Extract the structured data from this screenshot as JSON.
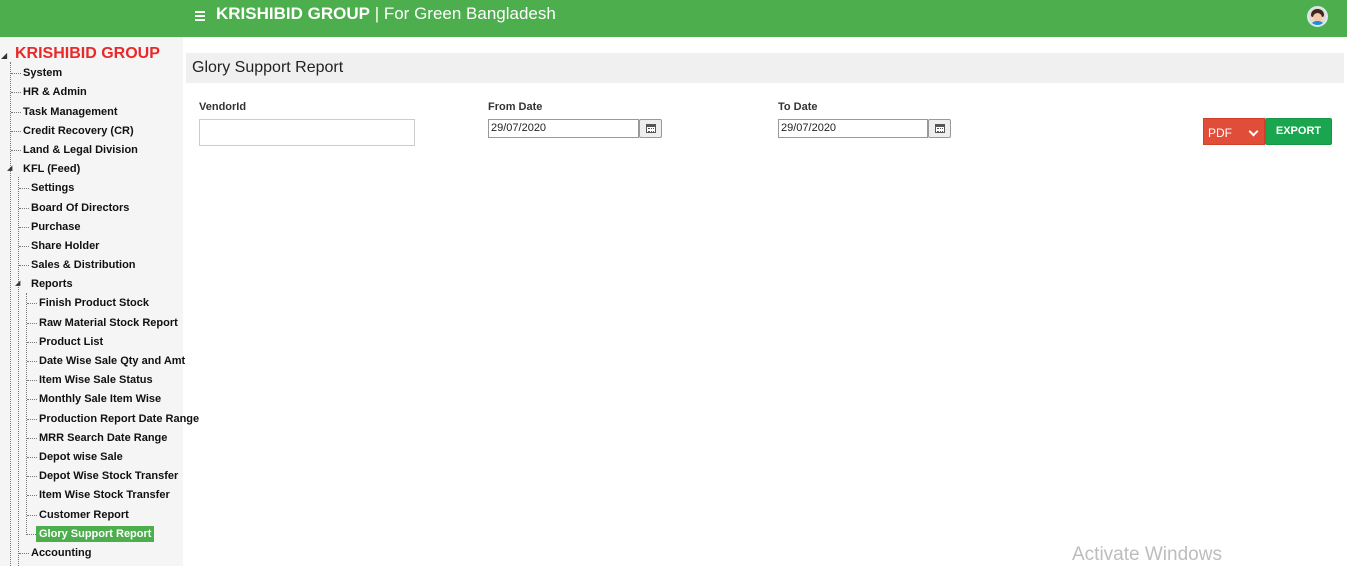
{
  "header": {
    "brand_name": "KRISHIBID GROUP",
    "brand_separator": " | ",
    "brand_tagline": "For Green Bangladesh",
    "colors": {
      "bar": "#4cae4c"
    },
    "icons": [
      "hamburger-menu-icon",
      "user-avatar-icon"
    ]
  },
  "sidebar": {
    "root": "KRISHIBID GROUP",
    "items": [
      {
        "label": "System"
      },
      {
        "label": "HR & Admin"
      },
      {
        "label": "Task Management"
      },
      {
        "label": "Credit Recovery (CR)"
      },
      {
        "label": "Land & Legal Division"
      },
      {
        "label": "KFL (Feed)",
        "expanded": true
      }
    ],
    "kfl_children": [
      {
        "label": "Settings"
      },
      {
        "label": "Board Of Directors"
      },
      {
        "label": "Purchase"
      },
      {
        "label": "Share Holder"
      },
      {
        "label": "Sales & Distribution"
      },
      {
        "label": "Reports",
        "expanded": true
      },
      {
        "label": "Accounting"
      }
    ],
    "reports_children": [
      {
        "label": "Finish Product Stock"
      },
      {
        "label": "Raw Material Stock Report"
      },
      {
        "label": "Product List"
      },
      {
        "label": "Date Wise Sale Qty and Amt"
      },
      {
        "label": "Item Wise Sale Status"
      },
      {
        "label": "Monthly Sale Item Wise"
      },
      {
        "label": "Production Report Date Range"
      },
      {
        "label": "MRR Search Date Range"
      },
      {
        "label": "Depot wise Sale"
      },
      {
        "label": "Depot Wise Stock Transfer"
      },
      {
        "label": "Item Wise Stock Transfer"
      },
      {
        "label": "Customer Report"
      },
      {
        "label": "Glory Support Report",
        "active": true
      }
    ],
    "colors": {
      "root_text": "#e8292a",
      "active_bg": "#4cae4c"
    }
  },
  "page": {
    "title": "Glory Support Report",
    "filters": {
      "vendor_label": "VendorId",
      "vendor_value": "",
      "from_label": "From Date",
      "from_value": "29/07/2020",
      "to_label": "To Date",
      "to_value": "29/07/2020"
    },
    "export": {
      "format_selected": "PDF",
      "button_label": "EXPORT",
      "colors": {
        "format": "#e04e3a",
        "button": "#1aa64f"
      }
    }
  },
  "watermark": "Activate Windows"
}
